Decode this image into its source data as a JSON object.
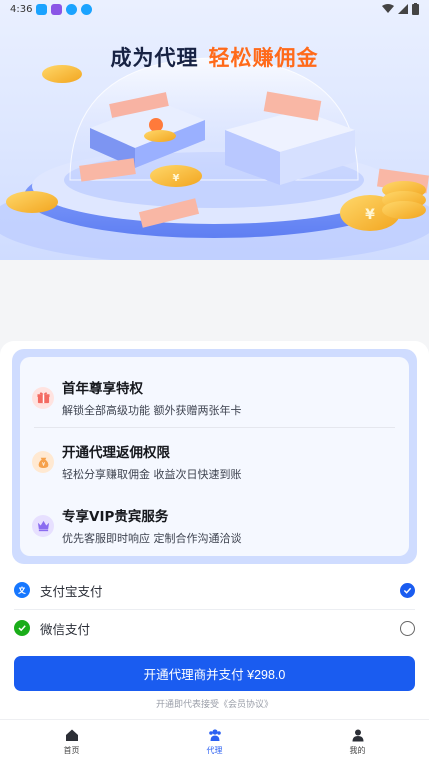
{
  "status_bar": {
    "time": "4:36"
  },
  "banner": {
    "title_part1": "成为代理",
    "title_part2": "轻松赚佣金"
  },
  "benefits": [
    {
      "title": "首年尊享特权",
      "desc": "解锁全部高级功能 额外获赠两张年卡",
      "icon": "gift-icon",
      "color": "#f36a61"
    },
    {
      "title": "开通代理返佣权限",
      "desc": "轻松分享赚取佣金 收益次日快速到账",
      "icon": "money-bag-icon",
      "color": "#f6a14b"
    },
    {
      "title": "专享VIP贵宾服务",
      "desc": "优先客服即时响应 定制合作沟通洽谈",
      "icon": "crown-icon",
      "color": "#8a6cf0"
    }
  ],
  "payment": {
    "options": [
      {
        "label": "支付宝支付",
        "icon": "alipay-icon",
        "selected": true
      },
      {
        "label": "微信支付",
        "icon": "wechat-icon",
        "selected": false
      }
    ]
  },
  "submit_label": "开通代理商并支付 ¥298.0",
  "agreement_text": "开通即代表接受《会员协议》",
  "tabs": [
    {
      "label": "首页",
      "icon": "home-icon",
      "active": false
    },
    {
      "label": "代理",
      "icon": "agent-icon",
      "active": true
    },
    {
      "label": "我的",
      "icon": "profile-icon",
      "active": false
    }
  ],
  "colors": {
    "primary": "#1a5cf0",
    "accent": "#ff6a1a",
    "panel": "#cfdcff"
  }
}
